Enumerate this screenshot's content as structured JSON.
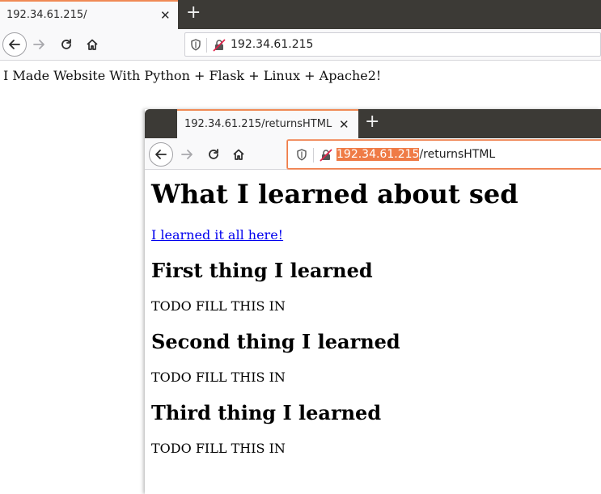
{
  "back_window": {
    "tab": {
      "title": "192.34.61.215/",
      "close": "✕"
    },
    "new_tab": "+",
    "url": "192.34.61.215",
    "body_text": "I Made Website With Python + Flask + Linux + Apache2!"
  },
  "front_window": {
    "tab": {
      "title": "192.34.61.215/returnsHTML",
      "close": "✕"
    },
    "new_tab": "+",
    "url_host": "192.34.61.215",
    "url_path": "/returnsHTML",
    "page": {
      "heading": "What I learned about sed",
      "link": "I learned it all here!",
      "sections": [
        {
          "title": "First thing I learned",
          "text": "TODO FILL THIS IN"
        },
        {
          "title": "Second thing I learned",
          "text": "TODO FILL THIS IN"
        },
        {
          "title": "Third thing I learned",
          "text": "TODO FILL THIS IN"
        }
      ]
    }
  },
  "colors": {
    "tab_accent": "#f08a55",
    "url_highlight": "#ef7b46",
    "link": "#0000ee",
    "tabbar_bg": "#3c3a36"
  }
}
